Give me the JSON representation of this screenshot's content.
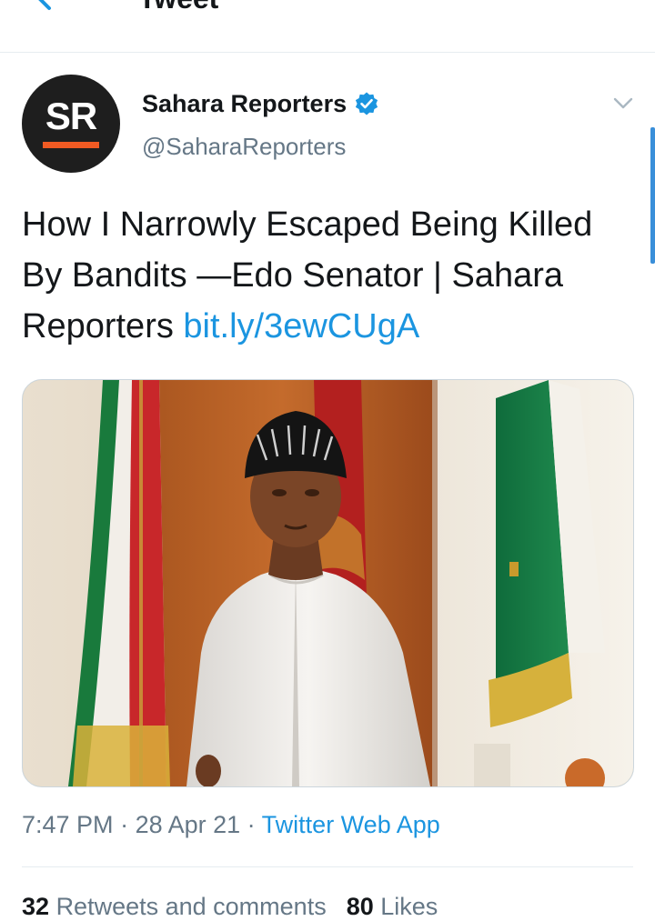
{
  "header": {
    "title": "Tweet",
    "back_icon": "back-arrow-icon"
  },
  "tweet": {
    "author": {
      "avatar_text": "SR",
      "display_name": "Sahara Reporters",
      "handle": "@SaharaReporters",
      "verified": true
    },
    "text": "How I Narrowly Escaped Being Killed By Bandits —Edo Senator | Sahara Reporters ",
    "link": "bit.ly/3ewCUgA",
    "media_description": "Man in white embroidered attire and black cap standing before flags",
    "meta": {
      "time": "7:47 PM",
      "separator1": " · ",
      "date": "28 Apr 21",
      "separator2": " · ",
      "source": "Twitter Web App"
    },
    "stats": {
      "retweets_count": "32",
      "retweets_label": "Retweets and comments",
      "likes_count": "80",
      "likes_label": "Likes"
    }
  },
  "colors": {
    "link_blue": "#1b95e0",
    "secondary_text": "#657786",
    "primary_text": "#14171a",
    "avatar_bg": "#1e1e1e",
    "avatar_accent": "#f05a23"
  }
}
